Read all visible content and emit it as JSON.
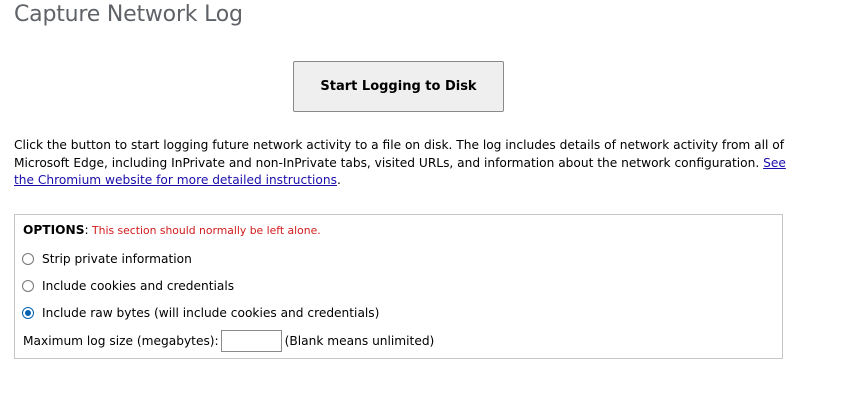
{
  "page": {
    "title": "Capture Network Log"
  },
  "start_button": {
    "label": "Start Logging to Disk"
  },
  "description": {
    "text": "Click the button to start logging future network activity to a file on disk. The log includes details of network activity from all of Microsoft Edge, including InPrivate and non-InPrivate tabs, visited URLs, and information about the network configuration. ",
    "link_text": "See the Chromium website for more detailed instructions",
    "trailing": "."
  },
  "options": {
    "label": "OPTIONS",
    "separator": ":",
    "note": " This section should normally be left alone.",
    "radios": [
      {
        "label": "Strip private information",
        "checked": false
      },
      {
        "label": "Include cookies and credentials",
        "checked": false
      },
      {
        "label": "Include raw bytes (will include cookies and credentials)",
        "checked": true
      }
    ],
    "max_size": {
      "label": "Maximum log size (megabytes):",
      "value": "",
      "hint": "(Blank means unlimited)"
    }
  },
  "colors": {
    "title": "#5f6368",
    "link": "#1a0dab",
    "note": "#d11b1b",
    "radio_checked": "#0063b1"
  }
}
